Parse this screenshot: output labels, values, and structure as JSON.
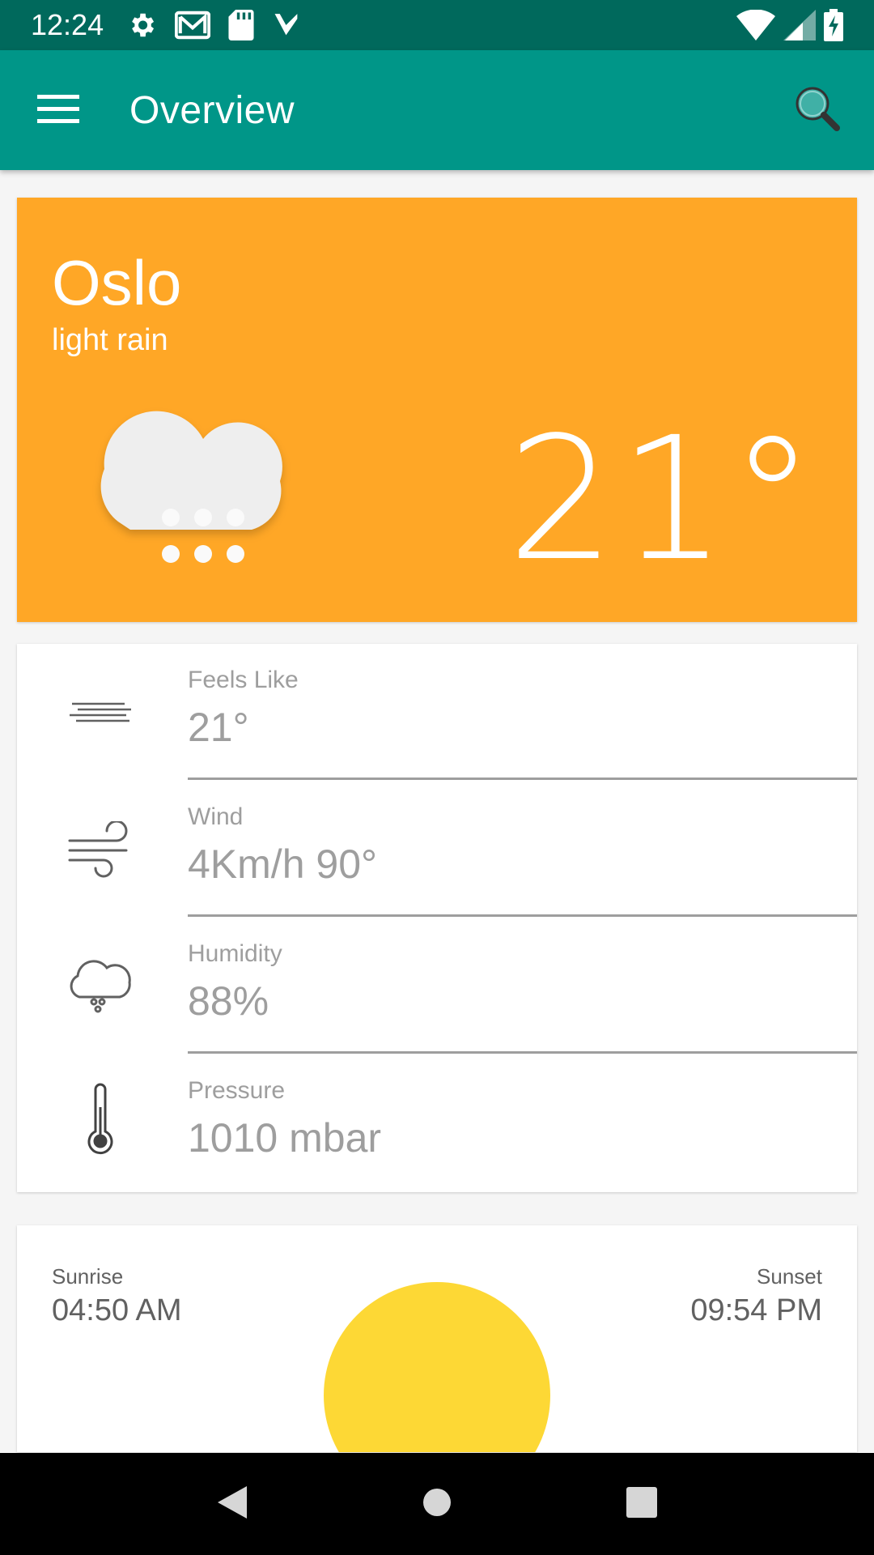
{
  "status_bar": {
    "time": "12:24",
    "icons": [
      "gear-icon",
      "gmail-icon",
      "sd-card-icon",
      "check-icon"
    ],
    "right_icons": [
      "wifi-icon",
      "signal-icon",
      "battery-charging-icon"
    ]
  },
  "app_bar": {
    "title": "Overview",
    "menu_icon": "hamburger-menu-icon",
    "search_icon": "search-icon",
    "color": "#009688"
  },
  "current": {
    "city": "Oslo",
    "condition": "light rain",
    "temperature": "21°",
    "icon": "rain-cloud-icon",
    "card_color": "#ffa726"
  },
  "details": [
    {
      "label": "Feels Like",
      "value": "21°",
      "icon": "haze-icon"
    },
    {
      "label": "Wind",
      "value": "4Km/h 90°",
      "icon": "wind-icon"
    },
    {
      "label": "Humidity",
      "value": "88%",
      "icon": "humidity-cloud-icon"
    },
    {
      "label": "Pressure",
      "value": "1010 mbar",
      "icon": "thermometer-icon"
    }
  ],
  "sun": {
    "sunrise_label": "Sunrise",
    "sunrise_time": "04:50 AM",
    "sunset_label": "Sunset",
    "sunset_time": "09:54 PM",
    "sun_color": "#fdd835"
  },
  "nav_bar": {
    "buttons": [
      "back-icon",
      "home-icon",
      "recents-icon"
    ]
  }
}
